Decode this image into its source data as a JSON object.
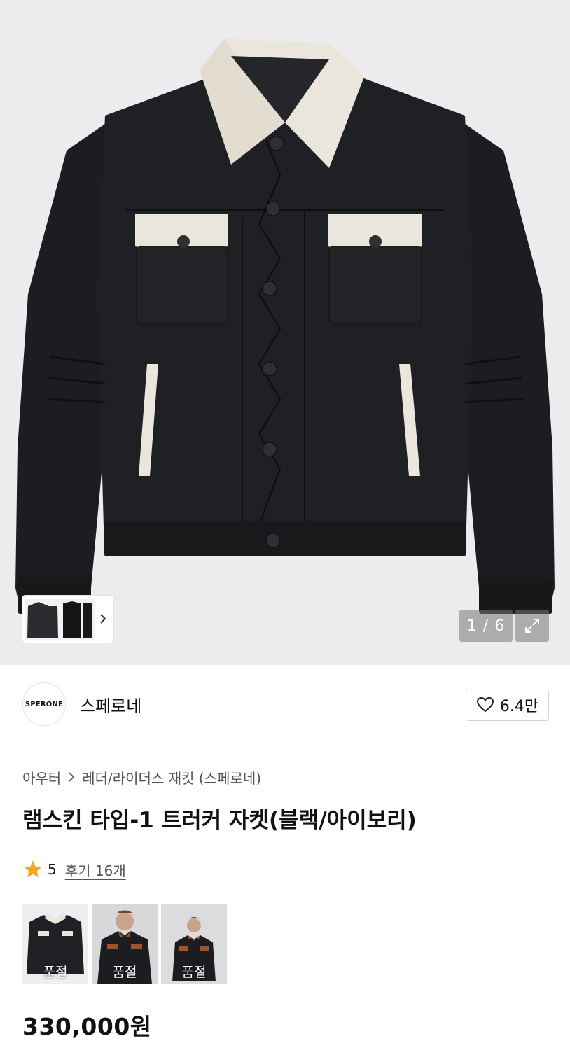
{
  "gallery": {
    "counter": "1 / 6"
  },
  "brand": {
    "logo_text": "SPERONE",
    "name": "스페로네",
    "likes": "6.4만"
  },
  "breadcrumb": {
    "category": "아우터",
    "subcategory": "레더/라이더스 재킷 (스페로네)"
  },
  "product": {
    "title": "램스킨 타입-1 트러커 자켓(블랙/아이보리)",
    "rating": "5",
    "reviews": "후기 16개",
    "price": "330,000원"
  },
  "variants": [
    {
      "status": "품절"
    },
    {
      "status": "품절"
    },
    {
      "status": "품절"
    }
  ],
  "colors": {
    "star": "#f5a623",
    "jacket": "#1c1d20",
    "ivory": "#ebe6dc",
    "brown": "#a0522d"
  },
  "icons": {
    "like": "heart-icon",
    "expand": "expand-icon",
    "next": "chevron-right-icon",
    "rating": "star-icon"
  }
}
